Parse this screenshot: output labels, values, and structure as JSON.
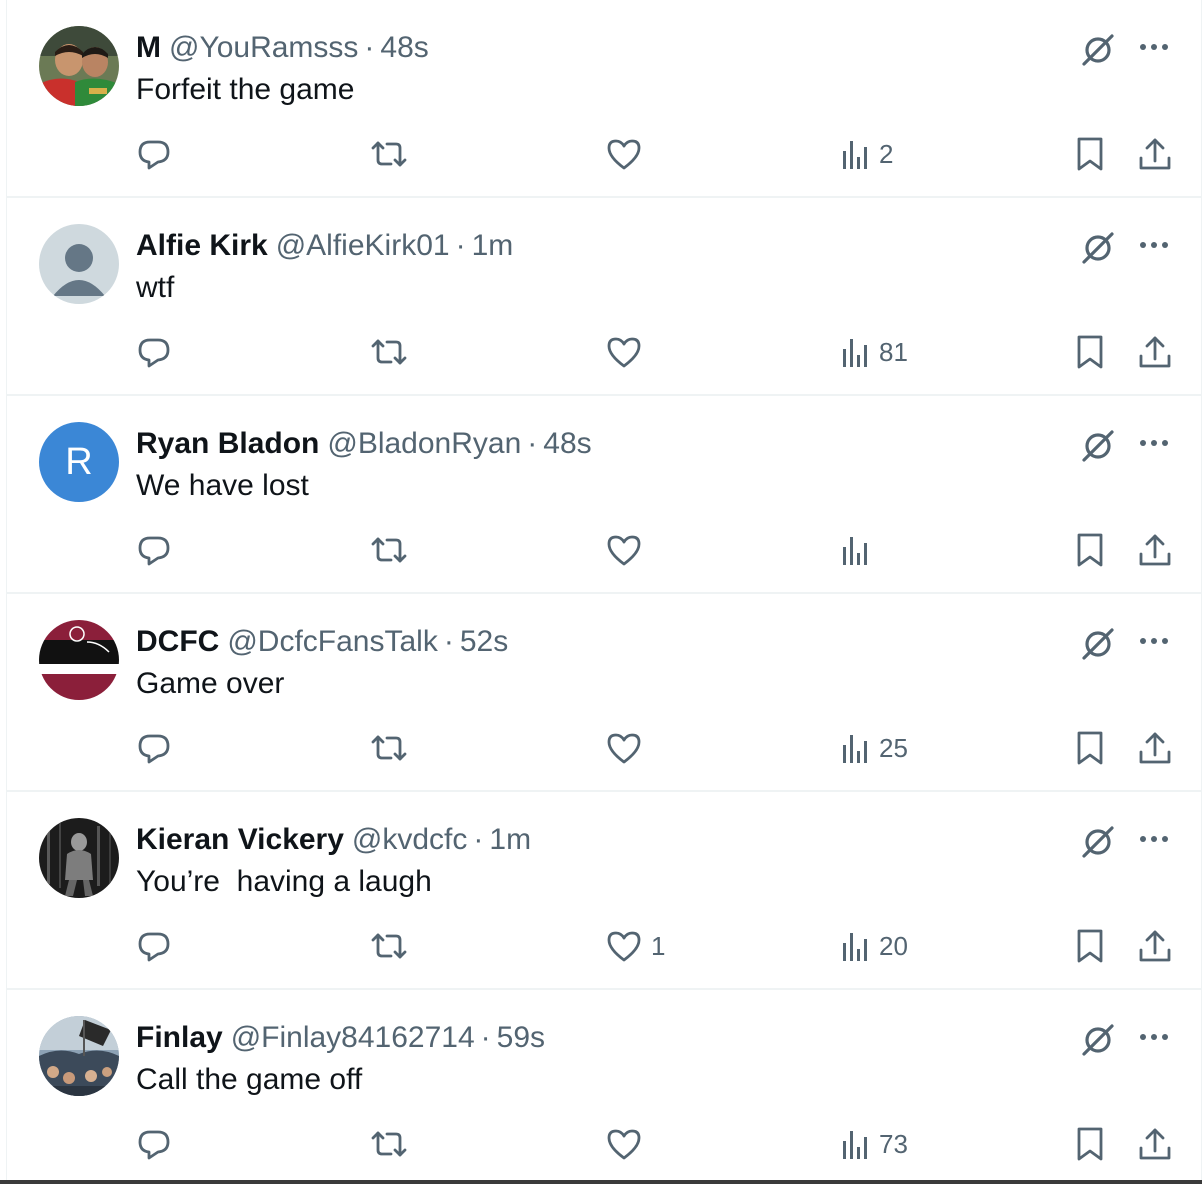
{
  "colors": {
    "text": "#0f1419",
    "muted": "#536471",
    "divider": "#eff3f4",
    "avatar_blue": "#3b87d6"
  },
  "icons": [
    "reply-icon",
    "retweet-icon",
    "like-icon",
    "views-icon",
    "bookmark-icon",
    "share-icon",
    "grok-icon",
    "more-icon"
  ],
  "tweets": [
    {
      "name": "M",
      "handle": "@YouRamsss",
      "dot": "·",
      "time": "48s",
      "text": "Forfeit the game",
      "likes": "",
      "views": "2",
      "avatar": "photo"
    },
    {
      "name": "Alfie Kirk",
      "handle": "@AlfieKirk01",
      "dot": "·",
      "time": "1m",
      "text": "wtf",
      "likes": "",
      "views": "81",
      "avatar": "default"
    },
    {
      "name": "Ryan Bladon",
      "handle": "@BladonRyan",
      "dot": "·",
      "time": "48s",
      "text": "We have lost",
      "likes": "",
      "views": "",
      "avatar_letter": "R"
    },
    {
      "name": "DCFC",
      "handle": "@DcfcFansTalk",
      "dot": "·",
      "time": "52s",
      "text": "Game over",
      "likes": "",
      "views": "25",
      "avatar": "club-colors"
    },
    {
      "name": "Kieran Vickery",
      "handle": "@kvdcfc",
      "dot": "·",
      "time": "1m",
      "text": "You’re  having a laugh",
      "likes": "1",
      "views": "20",
      "avatar": "photo-bw"
    },
    {
      "name": "Finlay",
      "handle": "@Finlay84162714",
      "dot": "·",
      "time": "59s",
      "text": "Call the game off",
      "likes": "",
      "views": "73",
      "avatar": "photo-crowd"
    }
  ]
}
